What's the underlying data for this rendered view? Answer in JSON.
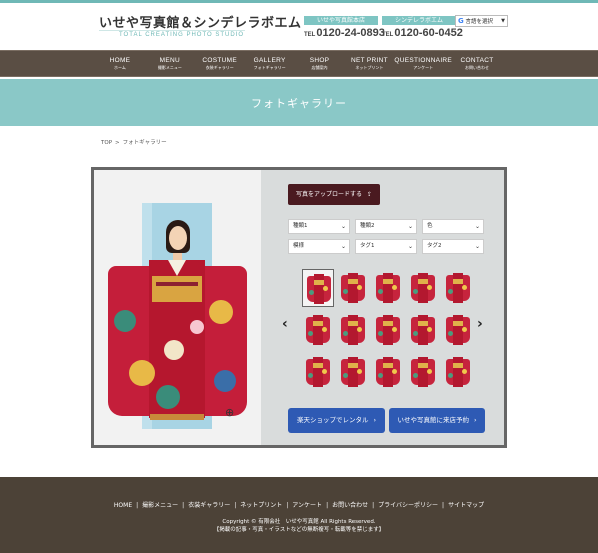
{
  "header": {
    "logo_title": "いせや写真館＆シンデレラボエム",
    "logo_subtitle": "TOTAL CREATING PHOTO STUDIO",
    "stores": [
      {
        "label": "いせや写真館本店",
        "tel_prefix": "TEL",
        "tel": "0120-24-0893"
      },
      {
        "label": "シンデレラボエム",
        "tel_prefix": "TEL",
        "tel": "0120-60-0452"
      }
    ],
    "language_select": "言語を選択"
  },
  "nav": [
    {
      "en": "HOME",
      "ja": "ホーム"
    },
    {
      "en": "MENU",
      "ja": "撮影メニュー"
    },
    {
      "en": "COSTUME",
      "ja": "衣装ギャラリー"
    },
    {
      "en": "GALLERY",
      "ja": "フォトギャラリー"
    },
    {
      "en": "SHOP",
      "ja": "店舗案内"
    },
    {
      "en": "NET PRINT",
      "ja": "ネットプリント"
    },
    {
      "en": "QUESTIONNAIRE",
      "ja": "アンケート"
    },
    {
      "en": "CONTACT",
      "ja": "お問い合わせ"
    }
  ],
  "banner": {
    "title": "フォトギャラリー"
  },
  "breadcrumb": {
    "home": "TOP",
    "separator": ">",
    "current": "フォトギャラリー"
  },
  "gallery": {
    "upload_button": "写真をアップロードする",
    "filters": [
      [
        "種類1",
        "種類2",
        "色"
      ],
      [
        "模様",
        "タグ1",
        "タグ2"
      ]
    ],
    "thumbnail_count": 15,
    "active_thumbnail": 0,
    "rent_button": "楽天ショップでレンタル",
    "reserve_button": "いせや写真館に来店予約"
  },
  "footer": {
    "links": [
      "HOME",
      "撮影メニュー",
      "衣装ギャラリー",
      "ネットプリント",
      "アンケート",
      "お問い合わせ",
      "プライバシーポリシー",
      "サイトマップ"
    ],
    "copyright": "Copyright © 有限会社　いせや写真館 All Rights Reserved.",
    "notice": "【掲載の記事・写真・イラストなどの無断複写・転載等を禁じます】"
  },
  "colors": {
    "accent": "#6fb8b6",
    "nav_bg": "#5a4e44",
    "banner_bg": "#8ac8c7",
    "upload_bg": "#4a1a20",
    "cta_bg": "#2e5ab4",
    "footer_bg": "#4c4237"
  }
}
